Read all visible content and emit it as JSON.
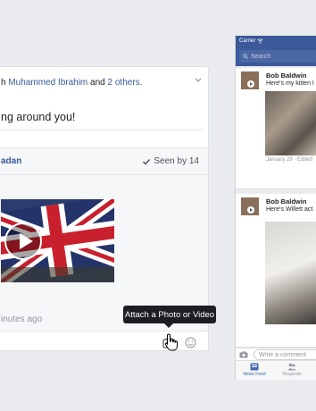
{
  "desktop_post": {
    "with_prefix": "h ",
    "tagged_person": "Muhammed Ibrahim",
    "and_text": " and ",
    "others_link": "2 others.",
    "post_text": "ng around you!",
    "thread_name_fragment": "adan",
    "seen_label": "Seen by 14",
    "time_ago": "inutes ago",
    "tooltip": "Attach a Photo or Video"
  },
  "mobile": {
    "carrier": "Carrier",
    "search_placeholder": "Search",
    "posts": [
      {
        "author": "Bob Baldwin",
        "caption": "Here's my kitten I",
        "date": "January 29 · Edited"
      },
      {
        "author": "Bob Baldwin",
        "caption": "Here's Willett act"
      }
    ],
    "comment_placeholder": "Write a comment",
    "tabs": [
      {
        "label": "News Feed"
      },
      {
        "label": "Requests"
      }
    ]
  },
  "colors": {
    "brand_blue": "#3b5998",
    "link_blue": "#365899",
    "background": "#e9ebee",
    "tooltip_bg": "#1c1e21"
  },
  "icons": [
    "chevron-down-icon",
    "checkmark-icon",
    "play-icon",
    "camera-icon",
    "smiley-icon",
    "hand-cursor-icon",
    "wifi-icon",
    "search-icon",
    "news-feed-icon",
    "friend-requests-icon"
  ]
}
